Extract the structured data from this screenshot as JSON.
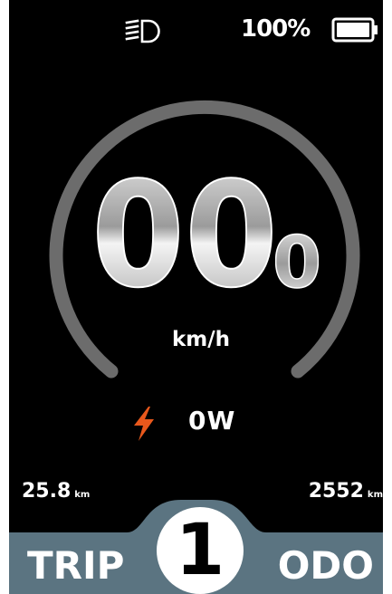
{
  "status_bar": {
    "headlight_icon": "headlight-icon",
    "battery_percent": "100%",
    "battery_level": 1.0
  },
  "speedometer": {
    "speed_main": "00",
    "speed_decimal": "0",
    "unit": "km/h"
  },
  "power": {
    "icon": "lightning-bolt-icon",
    "value": "0W",
    "accent_color": "#e8581c"
  },
  "distances": {
    "trip_value": "25.8",
    "trip_unit": "km",
    "odo_value": "2552",
    "odo_unit": "km"
  },
  "bottom": {
    "trip_label": "TRIP",
    "odo_label": "ODO",
    "assist_level": "1",
    "bar_color": "#5b7481"
  }
}
